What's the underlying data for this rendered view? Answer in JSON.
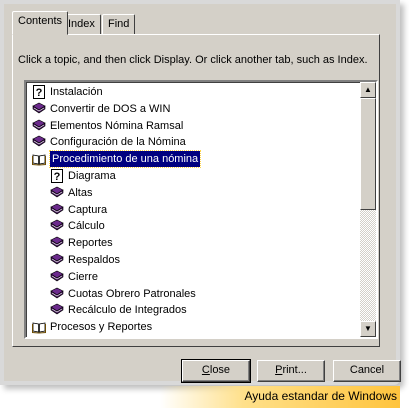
{
  "tabs": [
    {
      "label": "Contents",
      "active": true
    },
    {
      "label": "Index",
      "active": false
    },
    {
      "label": "Find",
      "active": false
    }
  ],
  "instruction": "Click a topic, and then click Display. Or click another tab, such as Index.",
  "tree": [
    {
      "label": "Instalación",
      "icon": "help-page-icon",
      "indent": 0
    },
    {
      "label": "Convertir de DOS a WIN",
      "icon": "book-closed-icon",
      "indent": 0
    },
    {
      "label": "Elementos Nómina Ramsal",
      "icon": "book-closed-icon",
      "indent": 0
    },
    {
      "label": "Configuración de la Nómina",
      "icon": "book-closed-icon",
      "indent": 0
    },
    {
      "label": "Procedimiento de una nómina",
      "icon": "book-open-icon",
      "indent": 0,
      "selected": true
    },
    {
      "label": "Diagrama",
      "icon": "help-page-icon",
      "indent": 1
    },
    {
      "label": "Altas",
      "icon": "book-closed-icon",
      "indent": 1
    },
    {
      "label": "Captura",
      "icon": "book-closed-icon",
      "indent": 1
    },
    {
      "label": "Cálculo",
      "icon": "book-closed-icon",
      "indent": 1
    },
    {
      "label": "Reportes",
      "icon": "book-closed-icon",
      "indent": 1
    },
    {
      "label": "Respaldos",
      "icon": "book-closed-icon",
      "indent": 1
    },
    {
      "label": "Cierre",
      "icon": "book-closed-icon",
      "indent": 1
    },
    {
      "label": "Cuotas Obrero Patronales",
      "icon": "book-closed-icon",
      "indent": 1
    },
    {
      "label": "Recálculo de Integrados",
      "icon": "book-closed-icon",
      "indent": 1
    },
    {
      "label": "Procesos y Reportes",
      "icon": "book-open-icon",
      "indent": 0
    }
  ],
  "buttons": {
    "close": {
      "label": "Close",
      "accel": "C",
      "rest": "lose"
    },
    "print": {
      "label": "Print...",
      "accel": "P",
      "rest": "rint..."
    },
    "cancel": {
      "label": "Cancel"
    }
  },
  "caption": "Ayuda estandar de Windows",
  "colors": {
    "selection": "#000080",
    "book": "#6b2a8c",
    "dialog": "#d4d0c8"
  }
}
